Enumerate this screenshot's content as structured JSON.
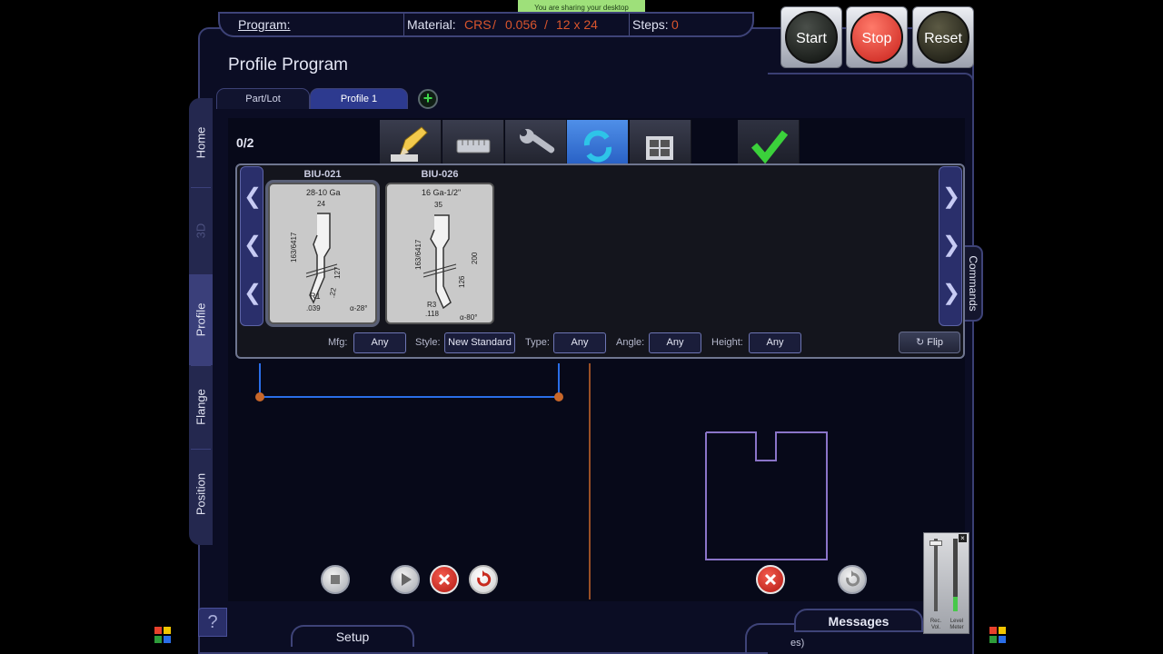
{
  "share_banner": "You are sharing your desktop",
  "header": {
    "program_label": "Program:",
    "material_label": "Material:",
    "material_type": "CRS",
    "material_sep1": "/",
    "material_thickness": "0.056",
    "material_sep2": "/",
    "material_size": "12 x 24",
    "steps_label": "Steps:",
    "steps_value": "0"
  },
  "controls": {
    "start": "Start",
    "stop": "Stop",
    "reset": "Reset"
  },
  "page_title": "Profile Program",
  "tabs": [
    {
      "label": "Part/Lot"
    },
    {
      "label": "Profile 1"
    }
  ],
  "add_tab": "+",
  "side_nav": {
    "home": "Home",
    "threed": "3D",
    "profile": "Profile",
    "flange": "Flange",
    "position": "Position"
  },
  "counter": "0/2",
  "tools": [
    {
      "name": "BIU-021",
      "spec": "28-10 Ga",
      "dims": [
        "24",
        "163/6417",
        "127",
        "R1",
        ".22",
        ".039",
        "α-28°"
      ]
    },
    {
      "name": "BIU-026",
      "spec": "16 Ga-1/2\"",
      "dims": [
        "35",
        "163/6417",
        "200",
        "126",
        "R3",
        ".118",
        "α-80°"
      ]
    }
  ],
  "filters": {
    "mfg_label": "Mfg:",
    "mfg_value": "Any",
    "style_label": "Style:",
    "style_value": "New Standard",
    "type_label": "Type:",
    "type_value": "Any",
    "angle_label": "Angle:",
    "angle_value": "Any",
    "height_label": "Height:",
    "height_value": "Any",
    "flip": "Flip"
  },
  "commands_tab": "Commands",
  "bottom": {
    "help": "?",
    "setup": "Setup",
    "messages": "Messages",
    "messages_fragment": "es)"
  },
  "meter": {
    "rec_vol": "Rec. Vol.",
    "level_meter": "Level Meter",
    "close": "×"
  },
  "colors": {
    "accent_blue": "#2d3a8f",
    "material_orange": "#d9552d",
    "start_green": "#1e6a2a",
    "stop_red": "#d8312a"
  }
}
